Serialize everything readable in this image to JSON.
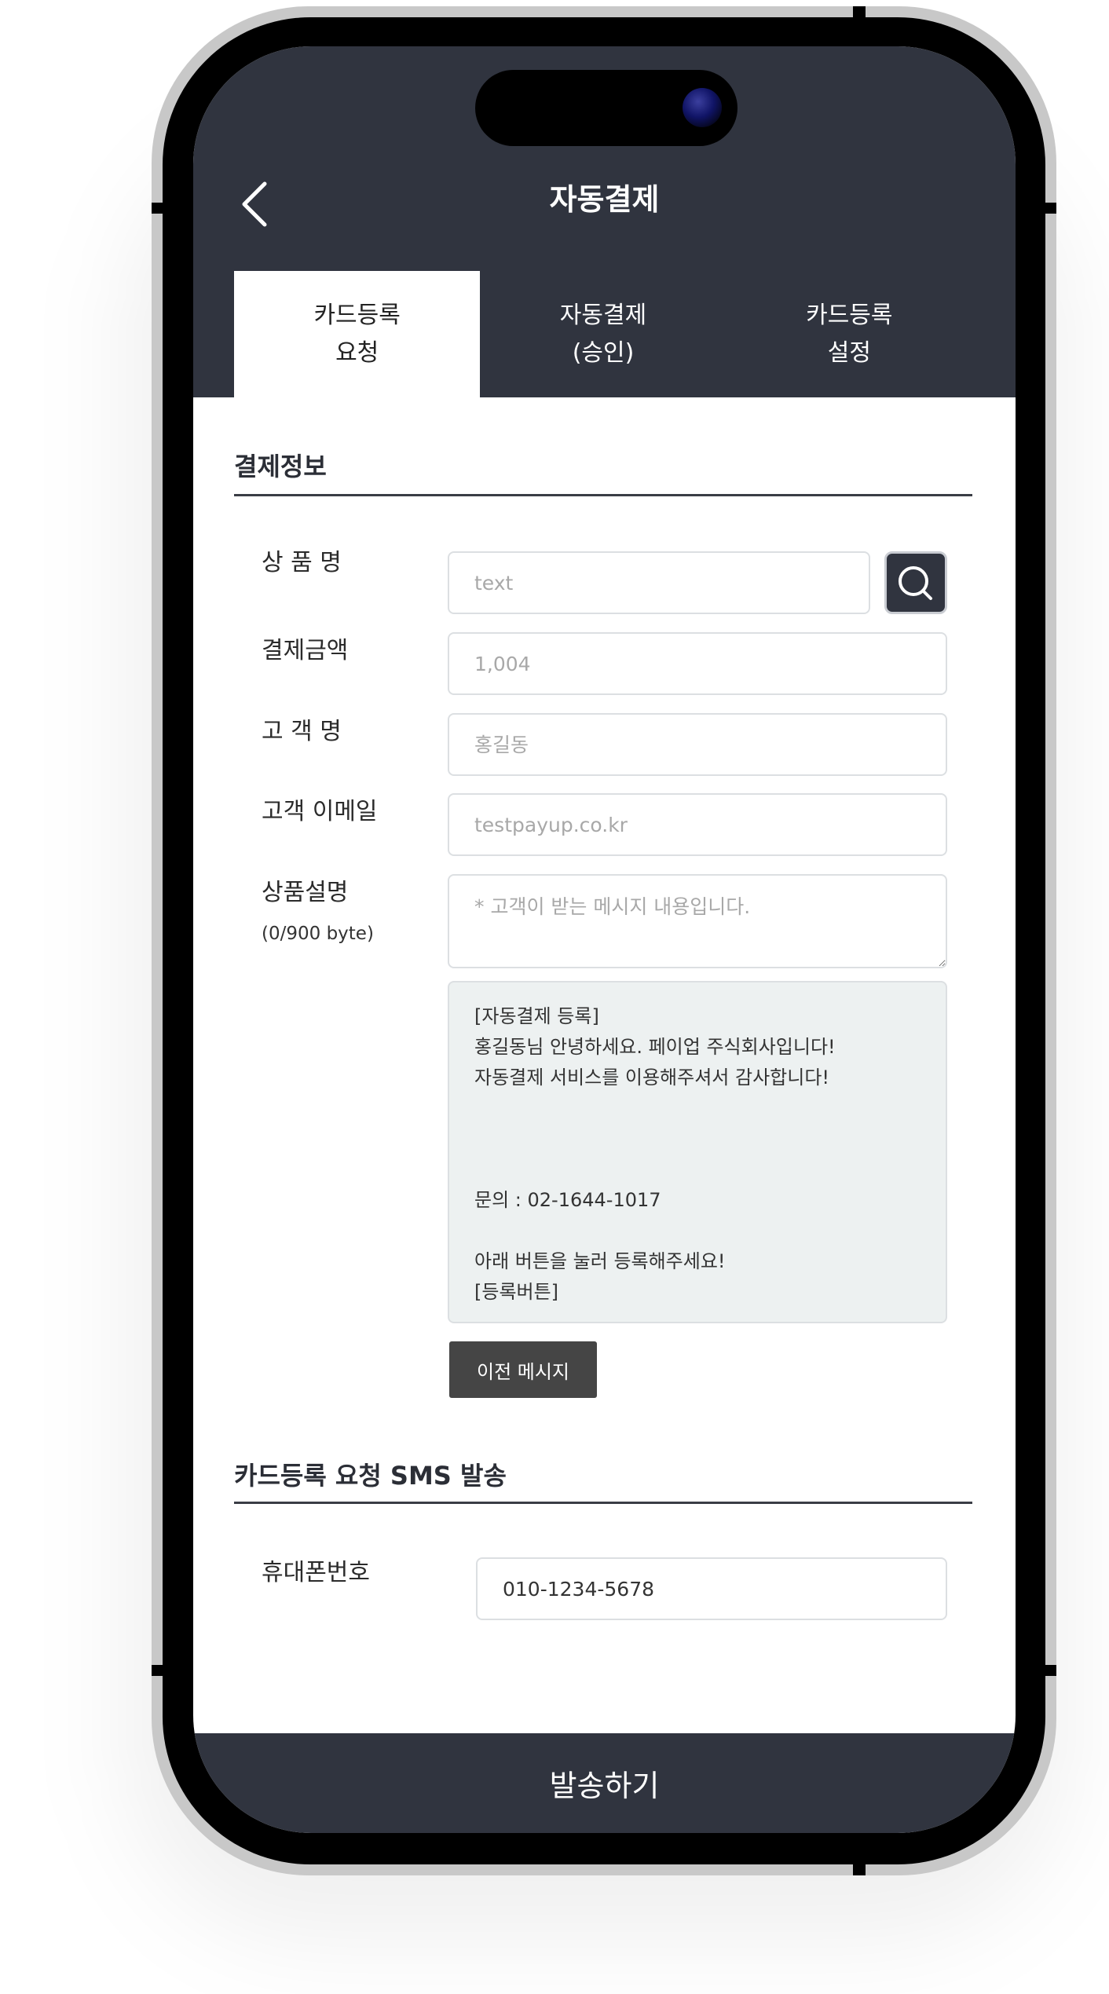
{
  "header": {
    "title": "자동결제",
    "back_icon": "chevron-left-icon"
  },
  "tabs": [
    {
      "line1": "카드등록",
      "line2": "요청",
      "active": true
    },
    {
      "line1": "자동결제",
      "line2": "(승인)",
      "active": false
    },
    {
      "line1": "카드등록",
      "line2": "설정",
      "active": false
    }
  ],
  "payment_info": {
    "section_title": "결제정보",
    "product_name_label": "상 품 명",
    "product_name_placeholder": "text",
    "amount_label": "결제금액",
    "amount_placeholder": "1,004",
    "customer_name_label": "고 객 명",
    "customer_name_placeholder": "홍길동",
    "email_label": "고객 이메일",
    "email_placeholder": "testpayup.co.kr",
    "description_label": "상품설명",
    "description_byte_count": "(0/900 byte)",
    "description_placeholder": "* 고객이 받는 메시지 내용입니다.",
    "search_icon": "search-icon"
  },
  "message_preview": {
    "lines": [
      "[자동결제 등록]",
      "홍길동님 안녕하세요. 페이업 주식회사입니다!",
      "자동결제 서비스를 이용해주셔서 감사합니다!",
      "",
      "",
      "",
      "문의 : 02-1644-1017",
      "",
      "아래 버튼을 눌러 등록해주세요!",
      "[등록버튼]"
    ]
  },
  "prev_message_button": "이전 메시지",
  "sms": {
    "section_title": "카드등록 요청 SMS 발송",
    "phone_label": "휴대폰번호",
    "phone_value": "010-1234-5678"
  },
  "send_button": "발송하기",
  "colors": {
    "header_bg": "#30343f",
    "message_bg": "#edf1f1",
    "prev_button_bg": "#454545"
  }
}
